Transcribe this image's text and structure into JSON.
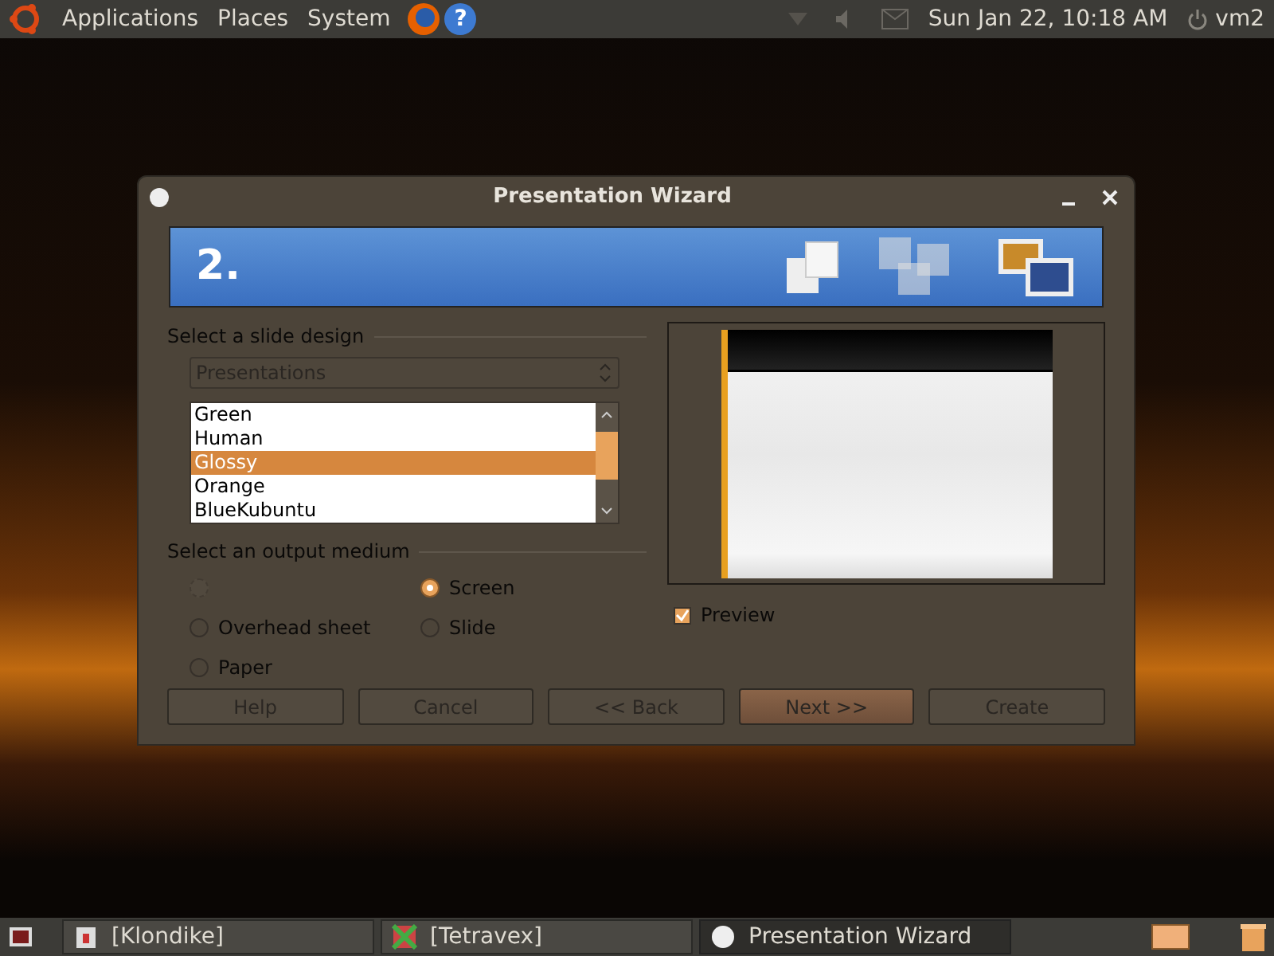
{
  "top_panel": {
    "menus": [
      "Applications",
      "Places",
      "System"
    ],
    "help": "?",
    "clock": "Sun Jan 22, 10:18 AM",
    "user": "vm2"
  },
  "window": {
    "title": "Presentation Wizard",
    "step": "2.",
    "design": {
      "heading": "Select a slide design",
      "dropdown": "Presentations",
      "items": [
        {
          "label": "Green",
          "selected": false
        },
        {
          "label": "Human",
          "selected": false
        },
        {
          "label": "Glossy",
          "selected": true
        },
        {
          "label": "Orange",
          "selected": false
        },
        {
          "label": "BlueKubuntu",
          "selected": false
        }
      ]
    },
    "output": {
      "heading": "Select an output medium",
      "options": [
        {
          "selected": false,
          "disabled": true
        },
        {
          "label": "Screen",
          "selected": true,
          "disabled": false
        },
        {
          "label": "Overhead sheet",
          "selected": false,
          "disabled": false
        },
        {
          "label": "Slide",
          "selected": false,
          "disabled": false
        },
        {
          "label": "Paper",
          "selected": false,
          "disabled": false
        }
      ]
    },
    "preview": {
      "label": "Preview",
      "checked": true
    },
    "buttons": [
      {
        "label": "Help",
        "default": false
      },
      {
        "label": "Cancel",
        "default": false
      },
      {
        "label": "<< Back",
        "default": false
      },
      {
        "label": "Next >>",
        "default": true
      },
      {
        "label": "Create",
        "default": false
      }
    ]
  },
  "taskbar": [
    {
      "label": "[Klondike]",
      "active": false
    },
    {
      "label": "[Tetravex]",
      "active": false
    },
    {
      "label": "Presentation Wizard",
      "active": true
    }
  ]
}
